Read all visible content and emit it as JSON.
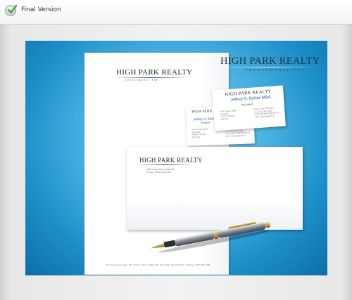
{
  "header": {
    "title": "Final Version",
    "status_icon": "check-icon"
  },
  "colors": {
    "stage": "#2a9ad3",
    "brand_text": "#2a2f38",
    "name_blue": "#2d66b8"
  },
  "letterhead": {
    "logo": "HIGH PARK REALTY",
    "sub": "Investments Inc.",
    "footer": "445 Yonge Street, Suite 854, Toronto, Ontario M4P 1S5 • Phone/Fax 416 780-2671 • Toll Free 1-877-867-5309"
  },
  "big_logo": {
    "text": "HIGH PARK REALTY",
    "sub": "Investments Inc."
  },
  "card_front": {
    "logo": "HIGH PARK REALTY",
    "name": "Jeffrey S. Bober MBA",
    "role": "President",
    "left_lines": [
      "2445 Yonge Street",
      "Suite 854",
      "Toronto, Ontario",
      "M4P 1S5"
    ],
    "right_lines": [
      "Direct: (416) 780-2671",
      "Fax: (416) 867-5309",
      "E-mail: jbober@highpark.ca",
      "Web: www.highpark.ca"
    ]
  },
  "card_back": {
    "logo": "HIGH PARK REALTY",
    "name": "Jeffrey S. Bober",
    "role": "President",
    "left_lines": [
      "2445 Yonge Street",
      "Suite 854",
      "Toronto, Ontario",
      "M4P 1S5"
    ],
    "right_lines": [
      "Direct: (416) 780-2671",
      "Fax: (416) 867-5309",
      "E-mail: jbober@highpark.ca",
      "Web: www.highpark.ca"
    ]
  },
  "envelope": {
    "logo": "HIGH PARK REALTY",
    "address_lines": [
      "2445 Yonge Street, Suite 854,",
      "Toronto, Ontario M4P 1S5"
    ]
  }
}
